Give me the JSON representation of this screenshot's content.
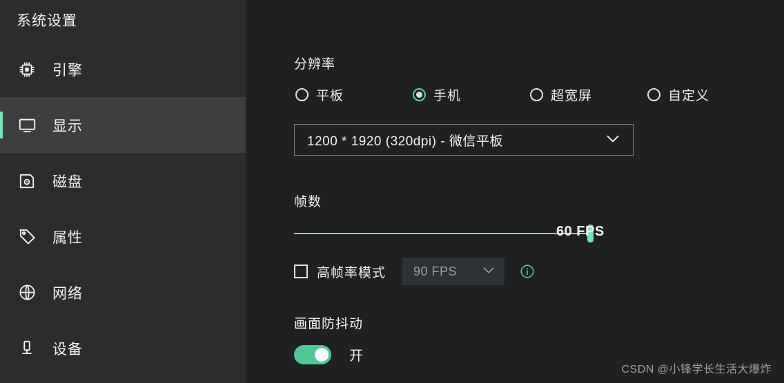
{
  "sidebar": {
    "title": "系统设置",
    "items": [
      {
        "label": "引擎",
        "icon": "cpu-chip-icon",
        "key": "engine",
        "selected": false
      },
      {
        "label": "显示",
        "icon": "monitor-icon",
        "key": "display",
        "selected": true
      },
      {
        "label": "磁盘",
        "icon": "floppy-disk-icon",
        "key": "disk",
        "selected": false
      },
      {
        "label": "属性",
        "icon": "tag-icon",
        "key": "properties",
        "selected": false
      },
      {
        "label": "网络",
        "icon": "globe-icon",
        "key": "network",
        "selected": false
      },
      {
        "label": "设备",
        "icon": "device-stand-icon",
        "key": "device",
        "selected": false
      }
    ]
  },
  "main": {
    "resolution": {
      "title": "分辨率",
      "options": [
        {
          "label": "平板",
          "selected": false
        },
        {
          "label": "手机",
          "selected": true
        },
        {
          "label": "超宽屏",
          "selected": false
        },
        {
          "label": "自定义",
          "selected": false
        }
      ],
      "select_value": "1200 * 1920 (320dpi) - 微信平板"
    },
    "framerate": {
      "title": "帧数",
      "slider_value": "60 FPS",
      "slider_percent": 100,
      "high_fps_mode": {
        "label": "高帧率模式",
        "checked": false,
        "select_value": "90 FPS",
        "info_icon": "info-circle-icon"
      }
    },
    "anti_shake": {
      "title": "画面防抖动",
      "toggle_on": true,
      "toggle_label": "开"
    }
  },
  "watermark": "CSDN @小锋学长生活大爆炸",
  "colors": {
    "accent_green": "#6fe8b5",
    "toggle_green": "#4dc894",
    "sidebar_bg": "#2b2d2c",
    "main_bg": "#1e2022",
    "selected_row_bg": "#3c3f3e"
  }
}
